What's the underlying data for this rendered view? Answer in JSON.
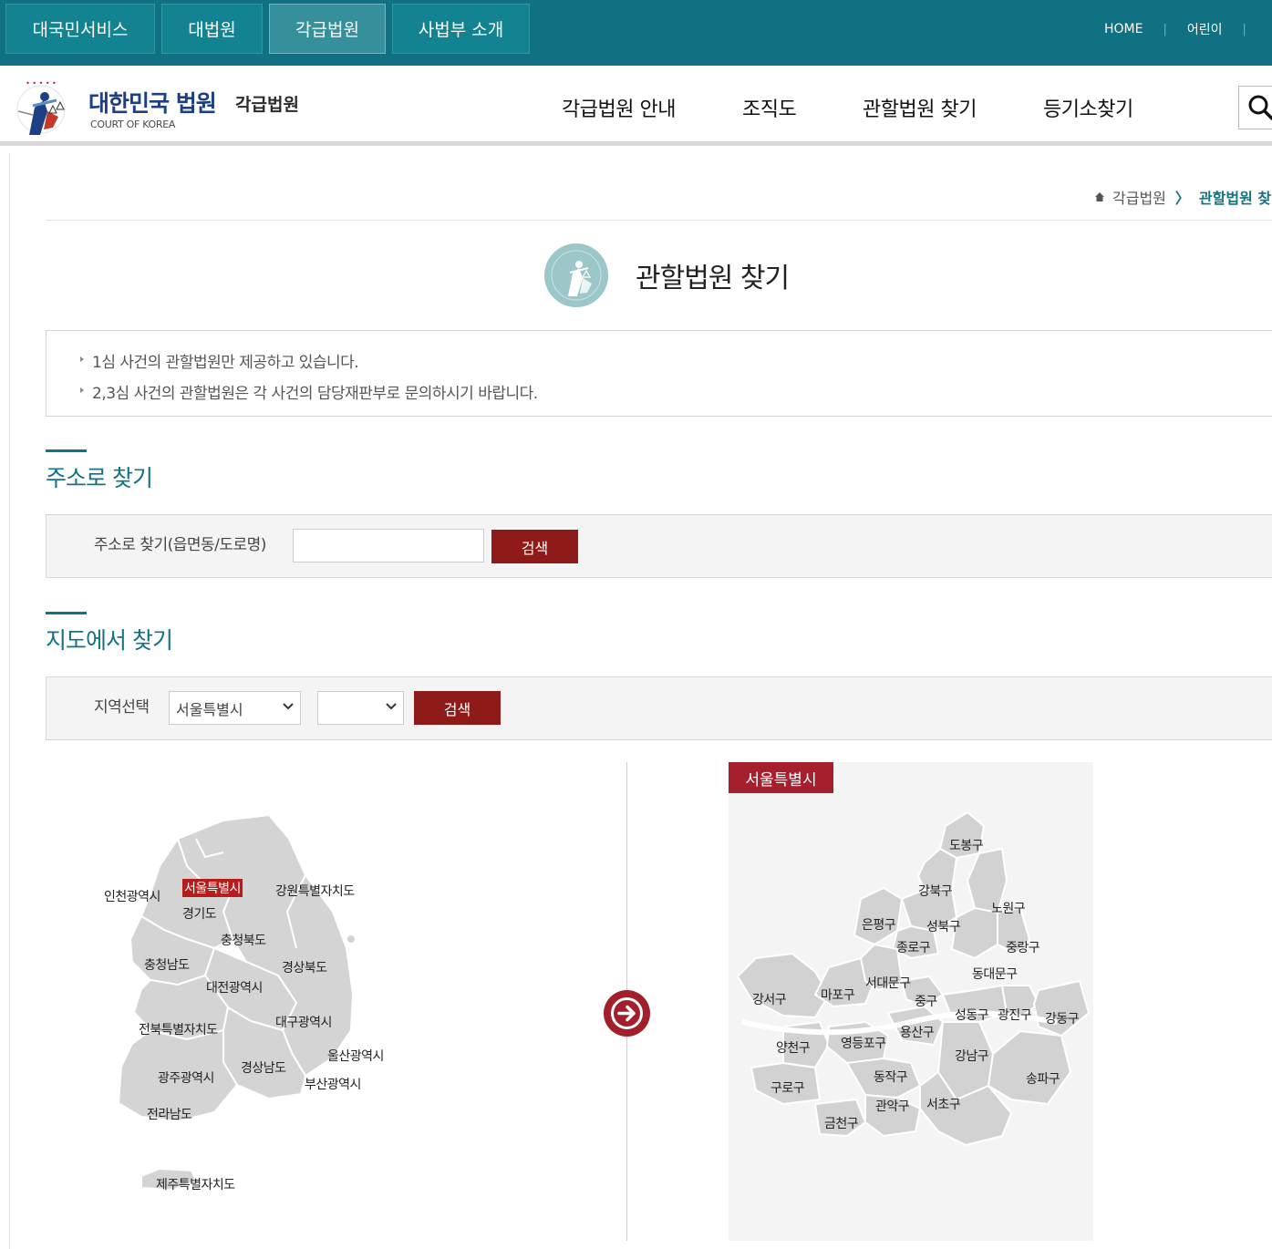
{
  "top_tabs": [
    {
      "label": "대국민서비스"
    },
    {
      "label": "대법원"
    },
    {
      "label": "각급법원"
    },
    {
      "label": "사법부 소개"
    }
  ],
  "top_links": {
    "home": "HOME",
    "kids": "어린이",
    "sep": "|"
  },
  "logo": {
    "title": "대한민국 법원",
    "subtitle": "각급법원",
    "english": "COURT OF KOREA"
  },
  "gnb": [
    {
      "label": "각급법원 안내"
    },
    {
      "label": "조직도"
    },
    {
      "label": "관할법원 찾기"
    },
    {
      "label": "등기소찾기"
    }
  ],
  "breadcrumb": {
    "parent": "각급법원",
    "arrow": "〉",
    "current": "관할법원 찾기"
  },
  "page_title": "관할법원 찾기",
  "notice": [
    "1심 사건의 관할법원만 제공하고 있습니다.",
    "2,3심 사건의 관할법원은 각 사건의 담당재판부로 문의하시기 바랍니다."
  ],
  "address_search": {
    "title": "주소로 찾기",
    "label": "주소로 찾기(읍면동/도로명)",
    "value": "",
    "button": "검색"
  },
  "map_search": {
    "title": "지도에서 찾기",
    "label": "지역선택",
    "region_value": "서울특별시",
    "district_value": "",
    "button": "검색"
  },
  "korea_regions": [
    "인천광역시",
    "서울특별시",
    "강원특별자치도",
    "경기도",
    "충청북도",
    "충청남도",
    "경상북도",
    "대전광역시",
    "대구광역시",
    "전북특별자치도",
    "울산광역시",
    "경상남도",
    "광주광역시",
    "부산광역시",
    "전라남도",
    "제주특별자치도"
  ],
  "selected_region": "서울특별시",
  "seoul_districts": [
    "도봉구",
    "강북구",
    "노원구",
    "은평구",
    "성북구",
    "종로구",
    "중랑구",
    "동대문구",
    "강서구",
    "마포구",
    "서대문구",
    "중구",
    "성동구",
    "광진구",
    "강동구",
    "용산구",
    "양천구",
    "영등포구",
    "강남구",
    "구로구",
    "동작구",
    "송파구",
    "관악구",
    "서초구",
    "금천구"
  ],
  "colors": {
    "teal": "#0f7181",
    "accent_red": "#8f1a1a",
    "navy": "#1d3f86"
  }
}
